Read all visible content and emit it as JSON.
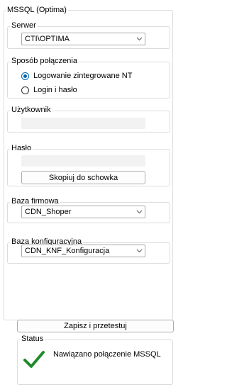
{
  "connection_group": {
    "title": "MSSQL (Optima)"
  },
  "server": {
    "label": "Serwer",
    "value": "CTI\\OPTIMA"
  },
  "connection_method": {
    "label": "Sposób połączenia",
    "options": [
      {
        "label": "Logowanie zintegrowane NT",
        "selected": true
      },
      {
        "label": "Login i hasło",
        "selected": false
      }
    ]
  },
  "user": {
    "label": "Użytkownik",
    "value": ""
  },
  "password": {
    "label": "Hasło",
    "value": "",
    "copy_button": "Skopiuj do schowka"
  },
  "company_db": {
    "label": "Baza firmowa",
    "value": "CDN_Shoper"
  },
  "config_db": {
    "label": "Baza konfiguracyjna",
    "value": "CDN_KNF_Konfiguracja"
  },
  "save_test_button": "Zapisz i przetestuj",
  "status": {
    "label": "Status",
    "message": "Nawiązano połączenie MSSQL",
    "color": "#1e8c2a"
  },
  "colors": {
    "accent": "#0063b1",
    "border": "#dcdcdc",
    "disabled_field": "#f2f2f2"
  }
}
